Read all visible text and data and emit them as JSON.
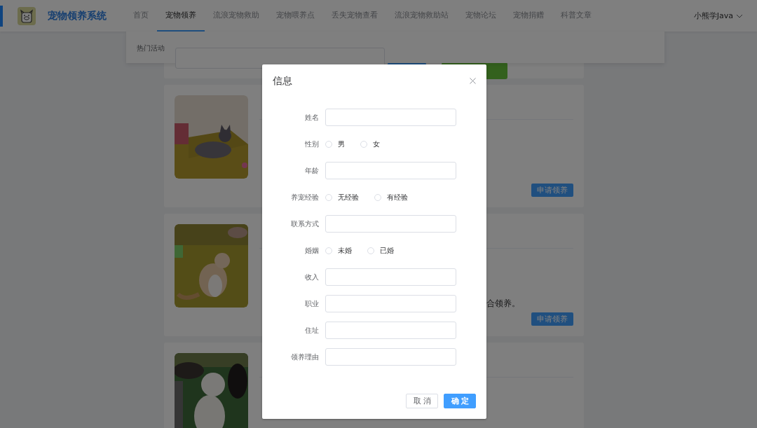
{
  "header": {
    "title": "宠物领养系统",
    "nav": [
      {
        "label": "首页",
        "selected": false
      },
      {
        "label": "宠物领养",
        "selected": true
      },
      {
        "label": "流浪宠物救助",
        "selected": false
      },
      {
        "label": "宠物喂养点",
        "selected": false
      },
      {
        "label": "丢失宠物查看",
        "selected": false
      },
      {
        "label": "流浪宠物救助站",
        "selected": false
      },
      {
        "label": "宠物论坛",
        "selected": false
      },
      {
        "label": "宠物捐赠",
        "selected": false
      },
      {
        "label": "科普文章",
        "selected": false
      }
    ],
    "user": "小熊学Java"
  },
  "submenu": {
    "items": [
      "热门活动"
    ]
  },
  "pets": [
    {
      "kind": "cat-grey",
      "button": "申请领养"
    },
    {
      "kind": "cat-orange",
      "text": "合领养。",
      "button": "申请领养"
    },
    {
      "kind": "dog"
    }
  ],
  "dialog": {
    "title": "信息",
    "fields": [
      {
        "kind": "input",
        "label": "姓名"
      },
      {
        "kind": "radio",
        "label": "性别",
        "options": [
          {
            "label": "男",
            "selected": false
          },
          {
            "label": "女",
            "selected": false
          }
        ]
      },
      {
        "kind": "input",
        "label": "年龄"
      },
      {
        "kind": "radio",
        "label": "养宠经验",
        "options": [
          {
            "label": "无经验",
            "selected": false
          },
          {
            "label": "有经验",
            "selected": false
          }
        ]
      },
      {
        "kind": "input",
        "label": "联系方式"
      },
      {
        "kind": "radio",
        "label": "婚姻",
        "options": [
          {
            "label": "未婚",
            "selected": false
          },
          {
            "label": "已婚",
            "selected": false
          }
        ]
      },
      {
        "kind": "input",
        "label": "收入"
      },
      {
        "kind": "input",
        "label": "职业"
      },
      {
        "kind": "input",
        "label": "住址"
      },
      {
        "kind": "input",
        "label": "领养理由"
      }
    ],
    "buttons": [
      {
        "label": "取消",
        "kind": "default"
      },
      {
        "label": "确定",
        "kind": "primary"
      }
    ]
  }
}
